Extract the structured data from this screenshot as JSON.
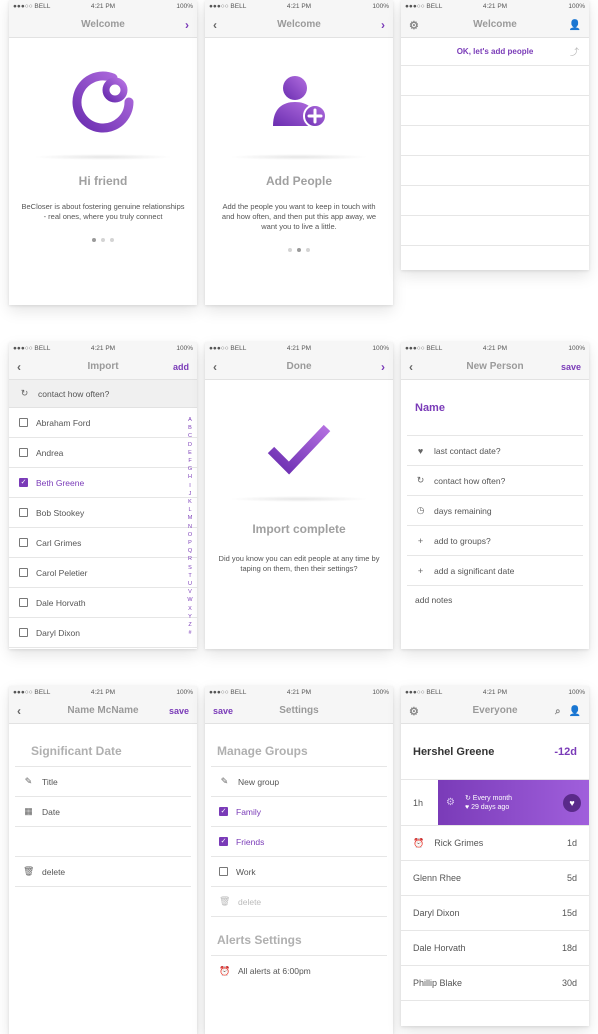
{
  "status": {
    "carrier": "●●●○○ BELL",
    "time": "4:21 PM",
    "battery": "100%"
  },
  "colors": {
    "accent": "#7a3bb8",
    "accent_light": "#b36fe0"
  },
  "screen1": {
    "nav_title": "Welcome",
    "hero_title": "Hi friend",
    "body": "BeCloser is about fostering genuine relationships - real ones, where you truly connect"
  },
  "screen2": {
    "nav_title": "Welcome",
    "hero_title": "Add People",
    "body": "Add the people you want to keep in touch with and how often, and then put this app away, we want you to live a little."
  },
  "screen3": {
    "nav_title": "Welcome",
    "banner": "OK, let's add people"
  },
  "screen4": {
    "nav_title": "Import",
    "nav_action": "add",
    "filter_label": "contact how often?",
    "contacts": [
      {
        "name": "Abraham Ford",
        "checked": false
      },
      {
        "name": "Andrea",
        "checked": false
      },
      {
        "name": "Beth Greene",
        "checked": true
      },
      {
        "name": "Bob Stookey",
        "checked": false
      },
      {
        "name": "Carl Grimes",
        "checked": false
      },
      {
        "name": "Carol Peletier",
        "checked": false
      },
      {
        "name": "Dale Horvath",
        "checked": false
      },
      {
        "name": "Daryl Dixon",
        "checked": false
      }
    ],
    "alphabet": [
      "A",
      "B",
      "C",
      "D",
      "E",
      "F",
      "G",
      "H",
      "I",
      "J",
      "K",
      "L",
      "M",
      "N",
      "O",
      "P",
      "Q",
      "R",
      "S",
      "T",
      "U",
      "V",
      "W",
      "X",
      "Y",
      "Z",
      "#"
    ]
  },
  "screen5": {
    "nav_title": "Done",
    "hero_title": "Import complete",
    "body": "Did you know you can edit people at any time by taping on them, then their settings?"
  },
  "screen6": {
    "nav_title": "New Person",
    "nav_action": "save",
    "name_label": "Name",
    "fields": [
      {
        "icon": "heart-icon",
        "label": "last contact date?"
      },
      {
        "icon": "repeat-icon",
        "label": "contact how often?"
      },
      {
        "icon": "clock-icon",
        "label": "days remaining"
      },
      {
        "icon": "plus-icon",
        "label": "add to groups?"
      },
      {
        "icon": "plus-icon",
        "label": "add a significant date"
      }
    ],
    "notes_label": "add notes"
  },
  "screen7": {
    "nav_title": "Name McName",
    "nav_action": "save",
    "section_title": "Significant Date",
    "title_label": "Title",
    "date_label": "Date",
    "delete_label": "delete"
  },
  "screen8": {
    "nav_title": "Settings",
    "nav_action": "save",
    "groups_title": "Manage Groups",
    "new_group_label": "New group",
    "groups": [
      {
        "name": "Family",
        "checked": true
      },
      {
        "name": "Friends",
        "checked": true
      },
      {
        "name": "Work",
        "checked": false
      }
    ],
    "delete_label": "delete",
    "alerts_title": "Alerts Settings",
    "alert_label": "All alerts at 6:00pm"
  },
  "screen9": {
    "nav_title": "Everyone",
    "top_name": "Hershel Greene",
    "top_days": "-12d",
    "swipe_left": "1h",
    "swipe_freq": "Every month",
    "swipe_ago": "29 days ago",
    "people": [
      {
        "name": "Rick Grimes",
        "days": "1d",
        "alarm": true
      },
      {
        "name": "Glenn Rhee",
        "days": "5d",
        "alarm": false
      },
      {
        "name": "Daryl Dixon",
        "days": "15d",
        "alarm": false
      },
      {
        "name": "Dale Horvath",
        "days": "18d",
        "alarm": false
      },
      {
        "name": "Phillip Blake",
        "days": "30d",
        "alarm": false
      }
    ]
  }
}
